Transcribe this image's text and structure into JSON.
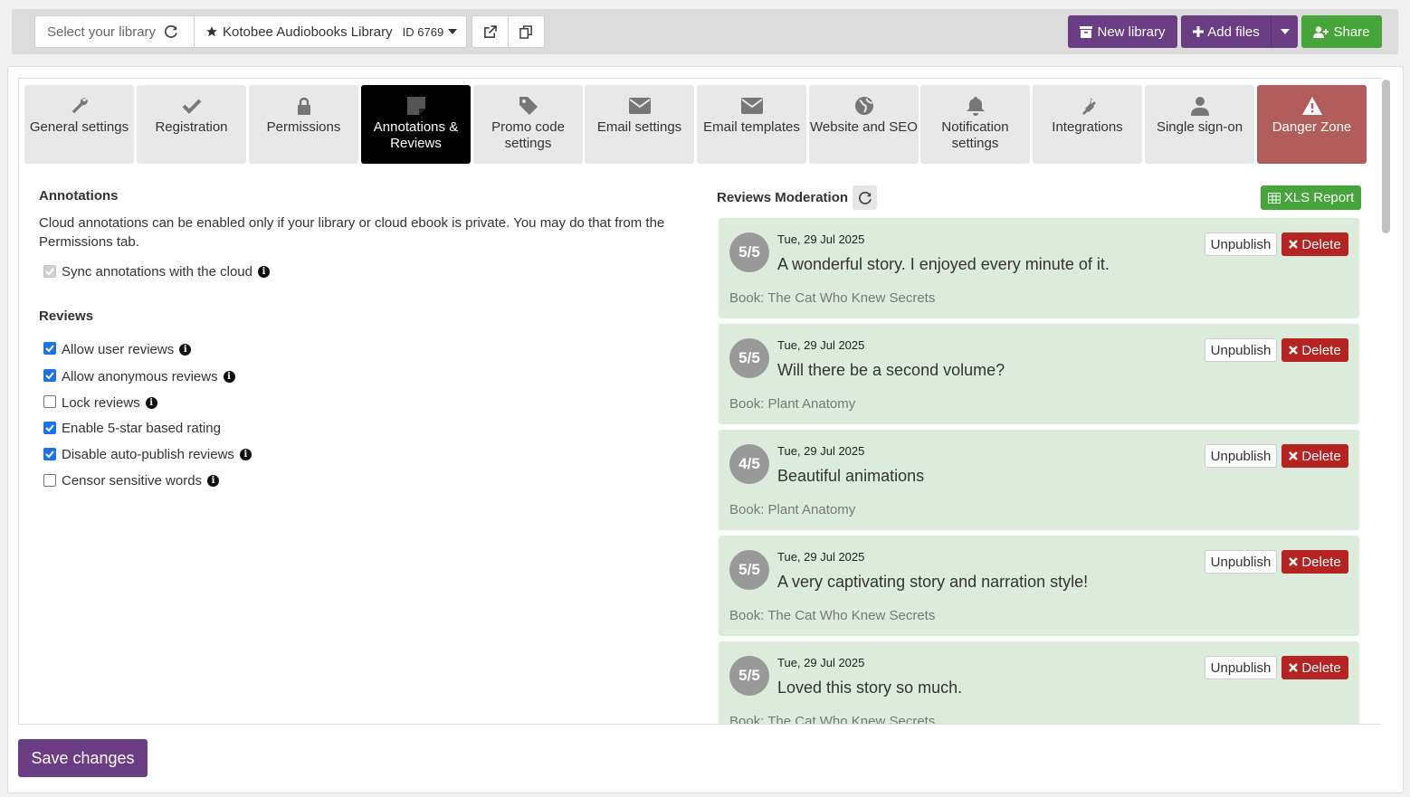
{
  "topbar": {
    "select_library": "Select your library",
    "library_name": "Kotobee Audiobooks Library",
    "library_id": "ID 6769",
    "new_library": "New library",
    "add_files": "Add files",
    "share": "Share"
  },
  "tabs": [
    {
      "label": "General settings",
      "icon": "wrench-icon"
    },
    {
      "label": "Registration",
      "icon": "check-icon"
    },
    {
      "label": "Permissions",
      "icon": "lock-icon"
    },
    {
      "label": "Annotations & Reviews",
      "icon": "note-icon"
    },
    {
      "label": "Promo code settings",
      "icon": "tag-icon"
    },
    {
      "label": "Email settings",
      "icon": "envelope-icon"
    },
    {
      "label": "Email templates",
      "icon": "envelope-icon"
    },
    {
      "label": "Website and SEO",
      "icon": "globe-icon"
    },
    {
      "label": "Notification settings",
      "icon": "bell-icon"
    },
    {
      "label": "Integrations",
      "icon": "plug-icon"
    },
    {
      "label": "Single sign-on",
      "icon": "user-icon"
    },
    {
      "label": "Danger Zone",
      "icon": "warning-icon"
    }
  ],
  "annotations": {
    "heading": "Annotations",
    "desc_line1": "Cloud annotations can be enabled only if your library or cloud ebook is private. You may do that from the",
    "desc_line2": "Permissions tab.",
    "sync_label": "Sync annotations with the cloud"
  },
  "reviews_settings": {
    "heading": "Reviews",
    "options": [
      {
        "label": "Allow user reviews",
        "checked": true
      },
      {
        "label": "Allow anonymous reviews",
        "checked": true
      },
      {
        "label": "Lock reviews",
        "checked": false
      },
      {
        "label": "Enable 5-star based rating",
        "checked": true
      },
      {
        "label": "Disable auto-publish reviews",
        "checked": true
      },
      {
        "label": "Censor sensitive words",
        "checked": false
      }
    ]
  },
  "moderation": {
    "heading": "Reviews Moderation",
    "xls_report": "XLS Report",
    "unpublish_label": "Unpublish",
    "delete_label": "Delete",
    "items": [
      {
        "rating": "5/5",
        "date": "Tue, 29 Jul 2025",
        "text": "A wonderful story. I enjoyed every minute of it.",
        "book": "Book: The Cat Who Knew Secrets"
      },
      {
        "rating": "5/5",
        "date": "Tue, 29 Jul 2025",
        "text": "Will there be a second volume?",
        "book": "Book: Plant Anatomy"
      },
      {
        "rating": "4/5",
        "date": "Tue, 29 Jul 2025",
        "text": "Beautiful animations",
        "book": "Book: Plant Anatomy"
      },
      {
        "rating": "5/5",
        "date": "Tue, 29 Jul 2025",
        "text": "A very captivating story and narration style!",
        "book": "Book: The Cat Who Knew Secrets"
      },
      {
        "rating": "5/5",
        "date": "Tue, 29 Jul 2025",
        "text": "Loved this story so much.",
        "book": "Book: The Cat Who Knew Secrets"
      }
    ]
  },
  "save_label": "Save changes"
}
